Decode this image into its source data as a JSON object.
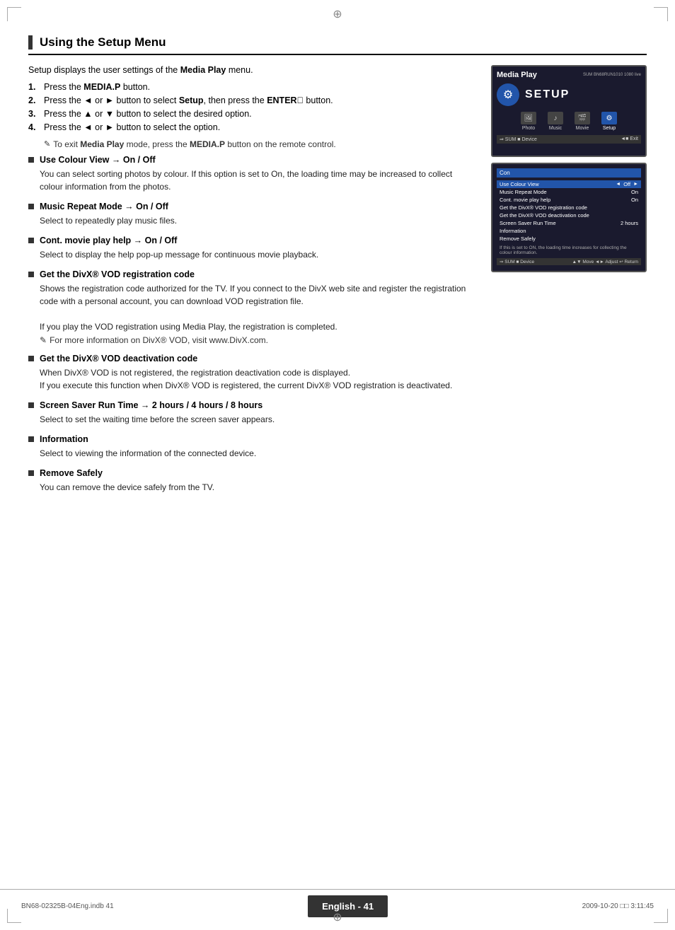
{
  "page": {
    "title": "Using the Setup Menu",
    "footer": {
      "page_label": "English - 41",
      "file_left": "BN68-02325B-04Eng.indb   41",
      "file_right": "2009-10-20   □□ 3:11:45"
    }
  },
  "intro": {
    "text": "Setup displays the user settings of the Media Play menu."
  },
  "steps": [
    {
      "num": "1.",
      "text": "Press the MEDIA.P button."
    },
    {
      "num": "2.",
      "text": "Press the ◄ or ► button to select Setup, then press the ENTER  button."
    },
    {
      "num": "3.",
      "text": "Press the ▲ or ▼ button to select the desired option."
    },
    {
      "num": "4.",
      "text": "Press the ◄ or ► button to select the option."
    }
  ],
  "note": "To exit Media Play mode, press the MEDIA.P button on the remote control.",
  "bullets": [
    {
      "id": "use-colour-view",
      "title": "Use Colour View → On / Off",
      "body": "You can select sorting photos by colour. If this option is set to On, the loading time may be increased to collect colour information from the photos."
    },
    {
      "id": "music-repeat-mode",
      "title": "Music Repeat Mode → On / Off",
      "body": "Select to repeatedly play music files."
    },
    {
      "id": "cont-movie-play-help",
      "title": "Cont. movie play help → On / Off",
      "body": "Select to display the help pop-up message for continuous movie playback."
    },
    {
      "id": "get-divx-registration",
      "title": "Get the DivX® VOD registration code",
      "body": "Shows the registration code authorized for the TV. If you connect to the DivX web site and register the registration code with a personal account, you can download VOD registration file.\nIf you play the VOD registration using Media Play, the registration is completed.",
      "note": "For more information on DivX® VOD, visit www.DivX.com."
    },
    {
      "id": "get-divx-deactivation",
      "title": "Get the DivX® VOD deactivation code",
      "body": "When DivX® VOD is not registered, the registration deactivation code is displayed.\nIf you execute this function when DivX® VOD is registered, the current DivX® VOD registration is deactivated."
    },
    {
      "id": "screen-saver",
      "title": "Screen Saver Run Time → 2 hours / 4 hours / 8 hours",
      "body": "Select to set the waiting time before the screen saver appears."
    },
    {
      "id": "information",
      "title": "Information",
      "body": "Select to viewing the information of the connected device."
    },
    {
      "id": "remove-safely",
      "title": "Remove Safely",
      "body": "You can remove the device safely from the TV."
    }
  ],
  "screen1": {
    "title": "Media Play",
    "info": "SUM BN68RUN1010 1080 live",
    "setup_label": "SETUP",
    "icons": [
      {
        "label": "Photo",
        "symbol": "🖼",
        "active": false
      },
      {
        "label": "Music",
        "symbol": "♪",
        "active": false
      },
      {
        "label": "Movie",
        "symbol": "🎬",
        "active": false
      },
      {
        "label": "Setup",
        "symbol": "⚙",
        "active": true
      }
    ],
    "bottom_left": "⇒ SUM   ■ Device",
    "bottom_right": "◄■ Exit"
  },
  "screen2": {
    "header_left": "Con",
    "header_right": "",
    "menu_items": [
      {
        "label": "Use Colour View",
        "value": "Off",
        "has_arrows": true,
        "highlighted": true
      },
      {
        "label": "Music Repeat Mode",
        "value": "On",
        "has_arrows": false,
        "highlighted": false
      },
      {
        "label": "Cont. movie play help",
        "value": "On",
        "has_arrows": false,
        "highlighted": false
      },
      {
        "label": "Get the DivX® VOD registration code",
        "value": "",
        "has_arrows": false,
        "highlighted": false
      },
      {
        "label": "Get the DivX® VOD deactivation code",
        "value": "",
        "has_arrows": false,
        "highlighted": false
      },
      {
        "label": "Screen Saver Run Time",
        "value": "2 hours",
        "has_arrows": false,
        "highlighted": false
      },
      {
        "label": "Information",
        "value": "",
        "has_arrows": false,
        "highlighted": false
      },
      {
        "label": "Remove Safely",
        "value": "",
        "has_arrows": false,
        "highlighted": false
      }
    ],
    "note_text": "If this is set to ON, the loading time increases for collecting the colour information.",
    "bottom": "⇒ SUM   ■ Device                    ▲▼ Move   ◄► Adjust   ↩ Return"
  }
}
